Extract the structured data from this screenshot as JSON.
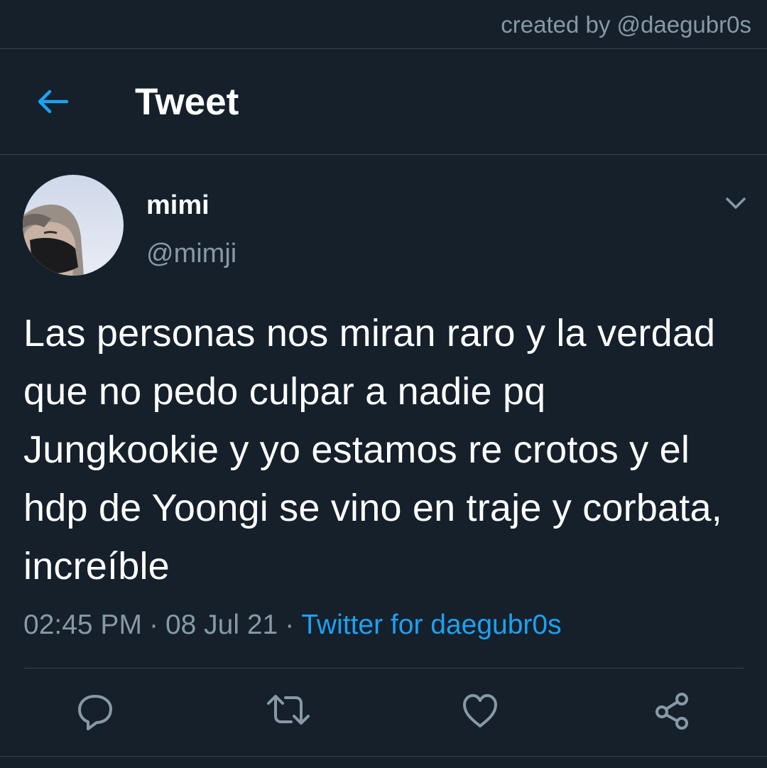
{
  "credit": "created by @daegubr0s",
  "header": {
    "title": "Tweet"
  },
  "tweet": {
    "display_name": "mimi",
    "handle": "@mimji",
    "text": "Las personas nos miran raro y la verdad que no pedo culpar a nadie pq Jungkookie y yo estamos re crotos y el hdp de Yoongi se vino en traje y corbata, increíble",
    "time": "02:45 PM",
    "date": "08 Jul 21",
    "separator": "·",
    "source": "Twitter for daegubr0s"
  },
  "icons": {
    "back": "arrow-left-icon",
    "caret": "chevron-down-icon",
    "reply": "reply-icon",
    "retweet": "retweet-icon",
    "like": "heart-icon",
    "share": "share-icon"
  },
  "colors": {
    "background": "#15202b",
    "accent": "#1da1f2",
    "secondary_text": "#8899a6",
    "divider": "#38444d"
  }
}
